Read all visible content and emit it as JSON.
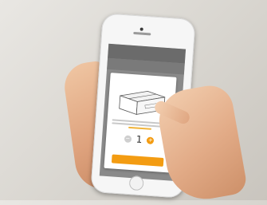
{
  "modal": {
    "quantity": "1",
    "minus_symbol": "−",
    "plus_symbol": "+"
  },
  "colors": {
    "accent": "#f39c12",
    "phone_body": "#f6f6f6",
    "skin": "#e2ab87"
  }
}
